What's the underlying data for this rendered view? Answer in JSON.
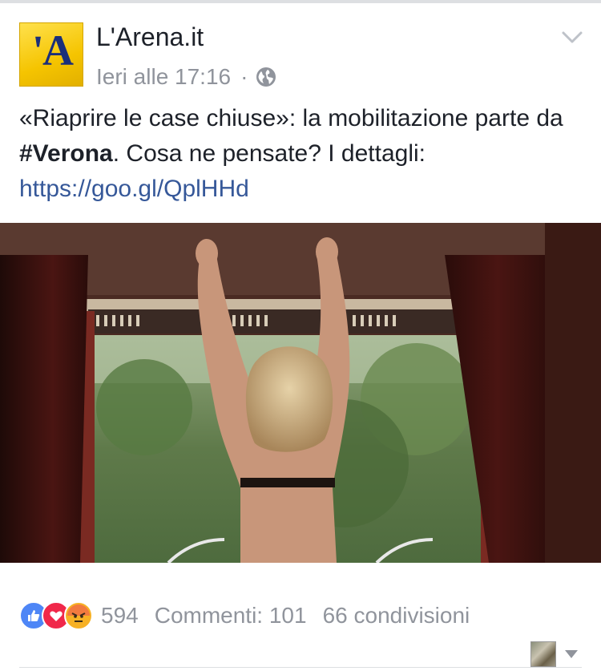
{
  "post": {
    "page_name": "L'Arena.it",
    "logo_letter": "'A",
    "timestamp": "Ieri alle 17:16",
    "separator": "·",
    "privacy_icon": "globe-icon",
    "options_icon": "chevron-down-icon",
    "text_part1": "«Riaprire le case chiuse»: la mobilitazione parte da ",
    "hashtag": "#Verona",
    "text_part2": ". Cosa ne pensate? I dettagli: ",
    "link": "https://goo.gl/QplHHd"
  },
  "footer": {
    "reactions_count": "594",
    "comments": "Commenti: 101",
    "shares": "66 condivisioni",
    "reaction_icons": [
      "like-icon",
      "love-icon",
      "angry-icon"
    ]
  },
  "colors": {
    "link": "#365899",
    "meta": "#90949c",
    "logo_bg": "#f5c400",
    "logo_letter": "#1b2f7a"
  }
}
